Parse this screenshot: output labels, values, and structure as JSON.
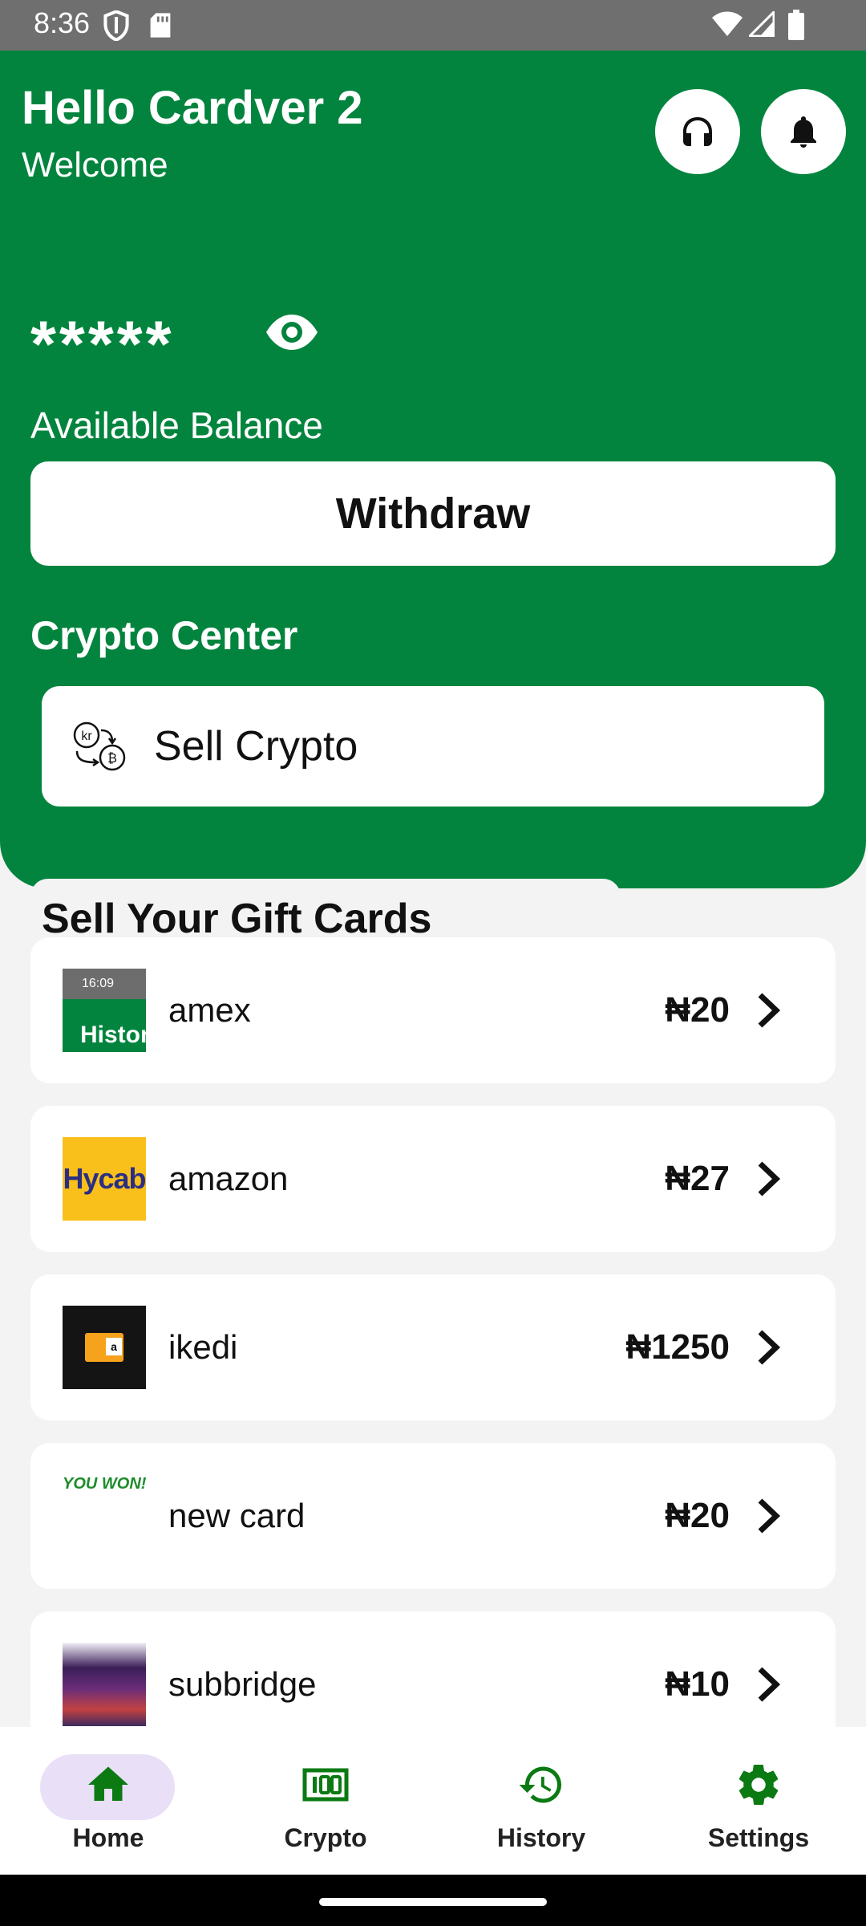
{
  "status": {
    "time": "8:36"
  },
  "header": {
    "greeting": "Hello Cardver 2",
    "subtitle": "Welcome",
    "support_icon": "headphones-icon",
    "notifications_icon": "bell-icon"
  },
  "balance": {
    "masked_value": "*****",
    "label": "Available Balance",
    "visibility_icon": "eye-icon"
  },
  "withdraw_label": "Withdraw",
  "crypto_center": {
    "heading": "Crypto Center",
    "sell_label": "Sell Crypto",
    "sell_icon": "currency-exchange-icon"
  },
  "giftcards": {
    "heading": "Sell Your Gift Cards",
    "items": [
      {
        "name": "amex",
        "price": "₦20",
        "thumb_text": "Histor",
        "thumb_time": "16:09"
      },
      {
        "name": "amazon",
        "price": "₦27",
        "thumb_text": "Hycab"
      },
      {
        "name": "ikedi",
        "price": "₦1250",
        "thumb_text": "a"
      },
      {
        "name": "new card",
        "price": "₦20",
        "thumb_text": "YOU WON!"
      },
      {
        "name": "subbridge",
        "price": "₦10"
      }
    ]
  },
  "nav": {
    "items": [
      {
        "label": "Home",
        "icon": "home-icon"
      },
      {
        "label": "Crypto",
        "icon": "crypto-100-icon"
      },
      {
        "label": "History",
        "icon": "history-icon"
      },
      {
        "label": "Settings",
        "icon": "gear-icon"
      }
    ],
    "active": "Home"
  },
  "colors": {
    "primary_green": "#03843e",
    "nav_icon_green": "#0b7a12",
    "active_pill": "#e9dff7",
    "background": "#f3f3f3"
  }
}
